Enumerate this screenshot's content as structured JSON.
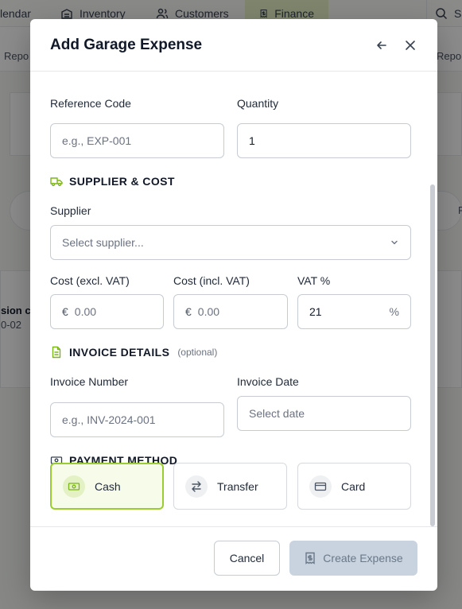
{
  "background": {
    "tabs": [
      {
        "label": "lendar"
      },
      {
        "label": "Inventory"
      },
      {
        "label": "Customers"
      },
      {
        "label": "Finance"
      }
    ],
    "search_partial": "S",
    "left_text": "Repo",
    "right_text": "Report",
    "row_title": "sion co",
    "row_sub": "0-02",
    "right_r": "F"
  },
  "modal": {
    "title": "Add Garage Expense",
    "reference_code": {
      "label": "Reference Code",
      "placeholder": "e.g., EXP-001",
      "value": ""
    },
    "quantity": {
      "label": "Quantity",
      "value": "1"
    },
    "supplier_section": {
      "title": "SUPPLIER & COST"
    },
    "supplier": {
      "label": "Supplier",
      "placeholder": "Select supplier..."
    },
    "cost_excl": {
      "label": "Cost (excl. VAT)",
      "prefix": "€",
      "placeholder": "0.00"
    },
    "cost_incl": {
      "label": "Cost (incl. VAT)",
      "prefix": "€",
      "placeholder": "0.00"
    },
    "vat": {
      "label": "VAT %",
      "value": "21",
      "suffix": "%"
    },
    "invoice_section": {
      "title": "INVOICE DETAILS",
      "optional": "(optional)"
    },
    "invoice_number": {
      "label": "Invoice Number",
      "placeholder": "e.g., INV-2024-001"
    },
    "invoice_date": {
      "label": "Invoice Date",
      "placeholder": "Select date"
    },
    "payment_section": {
      "title": "PAYMENT METHOD"
    },
    "payment_methods": [
      {
        "label": "Cash",
        "selected": true
      },
      {
        "label": "Transfer",
        "selected": false
      },
      {
        "label": "Card",
        "selected": false
      }
    ],
    "cancel_label": "Cancel",
    "create_label": "Create Expense"
  },
  "colors": {
    "accent": "#9acd32",
    "accent_bg": "#f7fbea",
    "disabled_button": "#c8d3df"
  }
}
